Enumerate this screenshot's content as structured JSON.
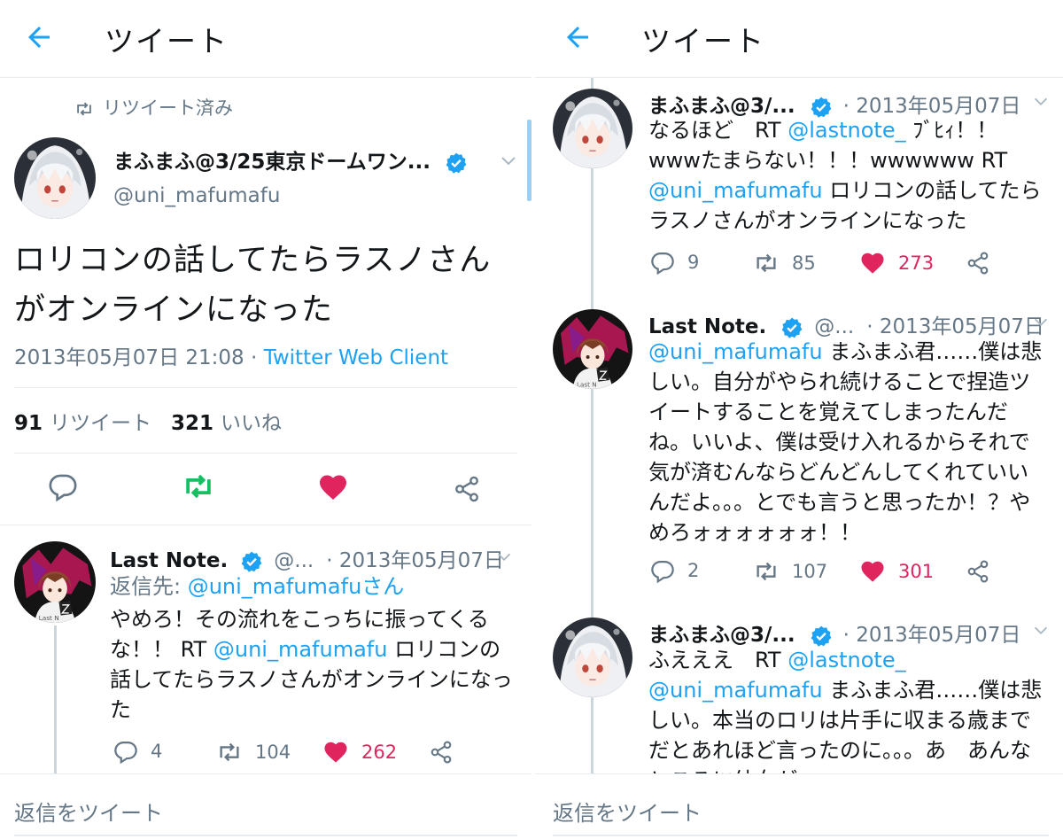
{
  "left": {
    "header": {
      "title": "ツイート"
    },
    "retweet_label": "リツイート済み",
    "main_tweet": {
      "name": "まふまふ@3/25東京ドームワン...",
      "handle": "@uni_mafumafu",
      "text": "ロリコンの話してたらラスノさんがオンラインになった",
      "date": "2013年05月07日 21:08",
      "dot": " · ",
      "client": "Twitter Web Client",
      "retweet_count": "91",
      "retweet_label": "リツイート",
      "like_count": "321",
      "like_label": "いいね"
    },
    "reply": {
      "name": "Last Note.",
      "handle": "@...",
      "date": "· 2013年05月07日",
      "reply_to_label": "返信先: ",
      "reply_to_user": "@uni_mafumafuさん",
      "text_1": "やめろ！その流れをこっちに振ってくるな！！ RT ",
      "mention": "@uni_mafumafu",
      "text_2": " ロリコンの話してたらラスノさんがオンラインになった",
      "replies": "4",
      "retweets": "104",
      "likes": "262"
    },
    "footer": {
      "placeholder": "返信をツイート"
    }
  },
  "right": {
    "header": {
      "title": "ツイート"
    },
    "tweets": [
      {
        "name": "まふまふ@3/...",
        "date": "· 2013年05月07日",
        "text_1": "なるほど　RT ",
        "mention_1": "@lastnote_",
        "text_2": " ﾌﾞﾋｨ！！wwwたまらない！！！wwwwww RT ",
        "mention_2": "@uni_mafumafu",
        "text_3": " ロリコンの話してたらラスノさんがオンラインになった",
        "replies": "9",
        "retweets": "85",
        "likes": "273"
      },
      {
        "name": "Last Note.",
        "handle": "@...",
        "date": "· 2013年05月07日",
        "mention_1": "@uni_mafumafu",
        "text_1": " まふまふ君……僕は悲しい。自分がやられ続けることで捏造ツイートすることを覚えてしまったんだね。いいよ、僕は受け入れるからそれで気が済むんならどんどんしてくれていいんだよ。。。とでも言うと思ったか！？やめろォォォォォォ！！",
        "replies": "2",
        "retweets": "107",
        "likes": "301"
      },
      {
        "name": "まふまふ@3/...",
        "date": "· 2013年05月07日",
        "text_1": "ふえええ　RT ",
        "mention_1": "@lastnote_",
        "mention_2": " @uni_mafumafu",
        "text_2": " まふまふ君……僕は悲しい。本当のロリは片手に収まる歳までだとあれほど言ったのに。。。あ　あんなところに幼女がァォォォォォォ！！！！！"
      }
    ],
    "footer": {
      "placeholder": "返信をツイート"
    }
  },
  "colors": {
    "accent": "#1da1f2",
    "like": "#e0245e",
    "retweet_active": "#17bf63",
    "muted": "#657786"
  },
  "icons": [
    "back-arrow-icon",
    "retweet-icon",
    "verified-badge-icon",
    "chevron-down-icon",
    "reply-icon",
    "like-icon",
    "share-icon",
    "avatar-mafumafu",
    "avatar-lastnote"
  ]
}
